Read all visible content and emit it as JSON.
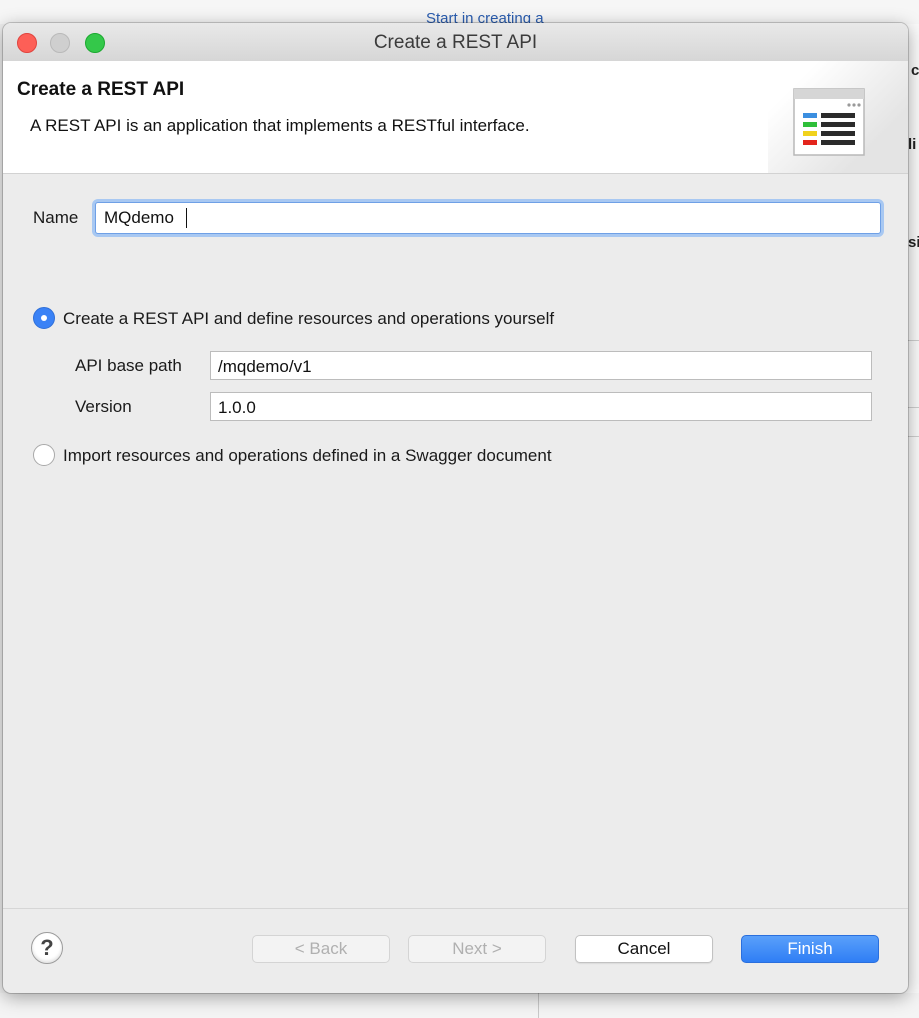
{
  "background": {
    "top_link": "Start in creating a",
    "right_fragments": [
      "c",
      "li",
      "si"
    ]
  },
  "dialog": {
    "window_title": "Create a REST API",
    "header": {
      "title": "Create a REST API",
      "description": "A REST API is an application that implements a RESTful interface.",
      "icon": "wizard-document-list-icon"
    },
    "name": {
      "label": "Name",
      "value": "MQdemo"
    },
    "options": [
      {
        "label": "Create a REST API and define resources and operations yourself",
        "selected": true
      },
      {
        "label": "Import resources and operations defined in a Swagger document",
        "selected": false
      }
    ],
    "api_base_path": {
      "label": "API base path",
      "value": "/mqdemo/v1"
    },
    "version": {
      "label": "Version",
      "value": "1.0.0"
    },
    "buttons": {
      "help": "?",
      "back": "< Back",
      "next": "Next >",
      "cancel": "Cancel",
      "finish": "Finish"
    }
  },
  "colors": {
    "accent": "#3a82f6",
    "focus_ring": "#a8c8f2",
    "close": "#fd5f57",
    "zoom": "#34c84a"
  }
}
